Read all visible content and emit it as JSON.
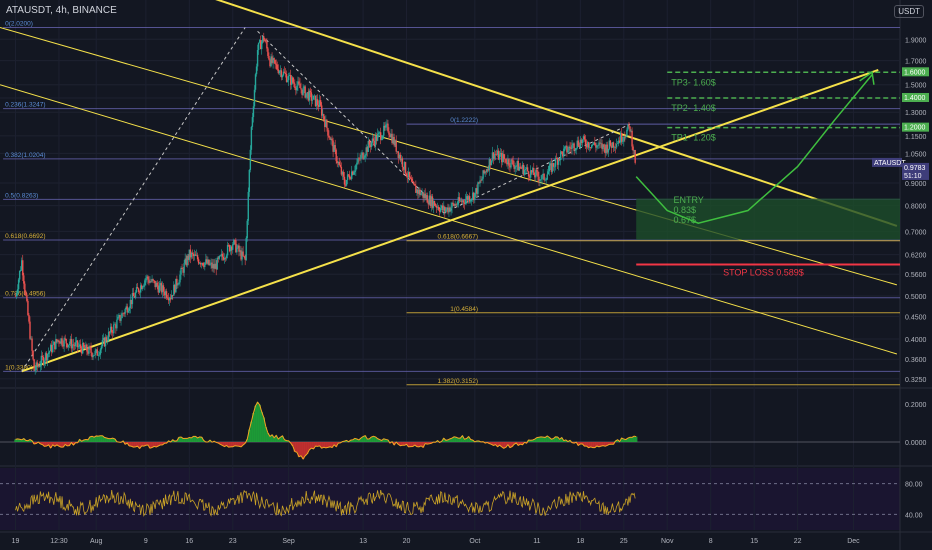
{
  "header": {
    "symbol_line": "ATAUSDT, 4h, BINANCE",
    "currency": "USDT"
  },
  "colors": {
    "background": "#131722",
    "up": "#26a69a",
    "down": "#ef5350",
    "fib": "#d8b13a",
    "fib_lines": "#6b68b8",
    "channel": "#f5e14a",
    "tp": "#4caf50",
    "stop": "#f23645",
    "entry_zone": "#1d4d2a"
  },
  "axis": {
    "price_ticks": [
      "1.9000",
      "1.7000",
      "1.5000",
      "1.4000",
      "1.3000",
      "1.1500",
      "1.0500",
      "0.9000",
      "0.8000",
      "0.7000",
      "0.6200",
      "0.5600",
      "0.5000",
      "0.4500",
      "0.4000",
      "0.3600",
      "0.3250"
    ],
    "time_ticks": [
      "19",
      "12:30",
      "Aug",
      "9",
      "16",
      "23",
      "Sep",
      "13",
      "20",
      "Oct",
      "11",
      "18",
      "25",
      "Nov",
      "8",
      "15",
      "22",
      "Dec"
    ],
    "osc_ticks": [
      "0.2000",
      "0.0000"
    ],
    "rsi_ticks": [
      "80.00",
      "40.00"
    ],
    "price_tags": [
      {
        "text": "1.6000",
        "kind": "tp"
      },
      {
        "text": "1.4000",
        "kind": "tp"
      },
      {
        "text": "1.2000",
        "kind": "tp"
      },
      {
        "text": "ATAUSDT",
        "kind": "sym"
      },
      {
        "text": "0.9783",
        "kind": "last"
      },
      {
        "text": "51:10",
        "kind": "last2"
      }
    ]
  },
  "fib_left": [
    {
      "label": "0(2.0200)",
      "price": 2.02
    },
    {
      "label": "0.236(1.3247)",
      "price": 1.3247
    },
    {
      "label": "0.382(1.0204)",
      "price": 1.0204
    },
    {
      "label": "0.5(0.8263)",
      "price": 0.8263
    },
    {
      "label": "0.618(0.6692)",
      "price": 0.6692
    },
    {
      "label": "0.786(0.4956)",
      "price": 0.4956
    },
    {
      "label": "1(0.3380)",
      "price": 0.338
    }
  ],
  "fib_right": [
    {
      "label": "0(1.2222)",
      "price": 1.2222
    },
    {
      "label": "0.618(0.6667)",
      "price": 0.6667
    },
    {
      "label": "1(0.4584)",
      "price": 0.4584
    },
    {
      "label": "1.382(0.3152)",
      "price": 0.3152
    }
  ],
  "annotations": {
    "tp3": "TP3- 1.60$",
    "tp2": "TP2- 1.40$",
    "tp1": "TP1- 1.20$",
    "entry": [
      "ENTRY",
      "0.83$",
      "0.67$"
    ],
    "stop": "STOP LOSS 0.589$"
  },
  "chart_data": {
    "type": "candlestick",
    "symbol": "ATAUSDT",
    "timeframe": "4h",
    "exchange": "BINANCE",
    "y_scale": "log",
    "ylim": [
      0.31,
      2.1
    ],
    "x_range": [
      "Jul 19",
      "Dec 5"
    ],
    "price_path": [
      [
        "Jul 19",
        0.5
      ],
      [
        "Jul 20",
        0.6
      ],
      [
        "Jul 22",
        0.34
      ],
      [
        "Jul 26",
        0.4
      ],
      [
        "Aug 1",
        0.37
      ],
      [
        "Aug 5",
        0.45
      ],
      [
        "Aug 9",
        0.55
      ],
      [
        "Aug 13",
        0.5
      ],
      [
        "Aug 16",
        0.62
      ],
      [
        "Aug 20",
        0.58
      ],
      [
        "Aug 23",
        0.66
      ],
      [
        "Aug 25",
        0.6
      ],
      [
        "Aug 26",
        1.2
      ],
      [
        "Aug 27",
        1.8
      ],
      [
        "Aug 28",
        1.92
      ],
      [
        "Aug 29",
        1.7
      ],
      [
        "Sep 1",
        1.55
      ],
      [
        "Sep 6",
        1.35
      ],
      [
        "Sep 10",
        0.9
      ],
      [
        "Sep 14",
        1.1
      ],
      [
        "Sep 17",
        1.2
      ],
      [
        "Sep 21",
        0.88
      ],
      [
        "Sep 26",
        0.78
      ],
      [
        "Oct 1",
        0.85
      ],
      [
        "Oct 4",
        1.05
      ],
      [
        "Oct 8",
        0.98
      ],
      [
        "Oct 12",
        0.92
      ],
      [
        "Oct 15",
        1.05
      ],
      [
        "Oct 18",
        1.12
      ],
      [
        "Oct 22",
        1.08
      ],
      [
        "Oct 24",
        1.12
      ],
      [
        "Oct 26",
        1.2
      ],
      [
        "Oct 27",
        0.9783
      ]
    ],
    "last_price": 0.9783,
    "levels": {
      "tp3": 1.6,
      "tp2": 1.4,
      "tp1": 1.2,
      "entry_high": 0.83,
      "entry_low": 0.67,
      "stop_loss": 0.589
    },
    "indicators": [
      {
        "name": "oscillator",
        "ticks": [
          0.2,
          0.0
        ]
      },
      {
        "name": "rsi",
        "ticks": [
          80,
          40
        ]
      }
    ]
  }
}
